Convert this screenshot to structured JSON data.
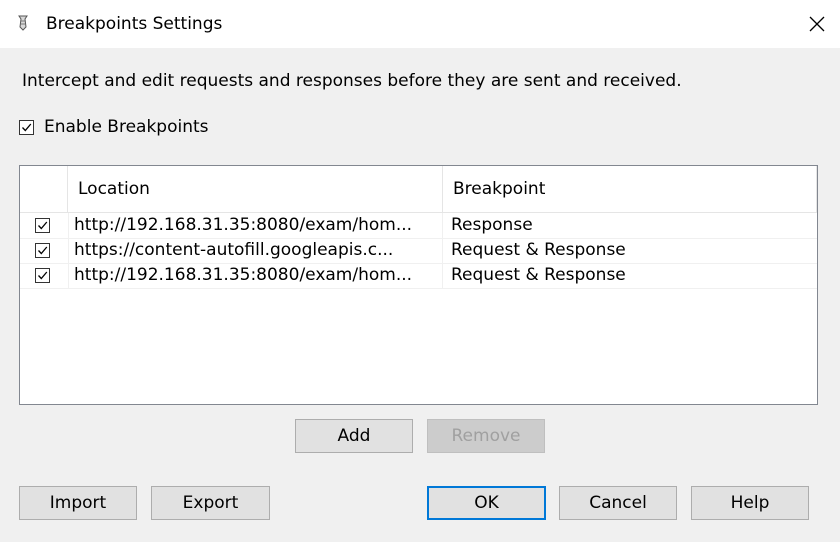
{
  "window": {
    "title": "Breakpoints Settings",
    "close_glyph": "✕"
  },
  "description": "Intercept and edit requests and responses before they are sent and received.",
  "enable_breakpoints": {
    "label": "Enable Breakpoints",
    "checked": true
  },
  "table": {
    "columns": [
      "Location",
      "Breakpoint"
    ],
    "rows": [
      {
        "checked": true,
        "location": "http://192.168.31.35:8080/exam/hom...",
        "breakpoint": "Response"
      },
      {
        "checked": true,
        "location": "https://content-autofill.googleapis.c...",
        "breakpoint": "Request & Response"
      },
      {
        "checked": true,
        "location": "http://192.168.31.35:8080/exam/hom...",
        "breakpoint": "Request & Response"
      }
    ]
  },
  "buttons": {
    "add": "Add",
    "remove": "Remove",
    "import": "Import",
    "export": "Export",
    "ok": "OK",
    "cancel": "Cancel",
    "help": "Help"
  },
  "colors": {
    "accent": "#0078d7",
    "dialog_bg": "#f0f0f0"
  }
}
